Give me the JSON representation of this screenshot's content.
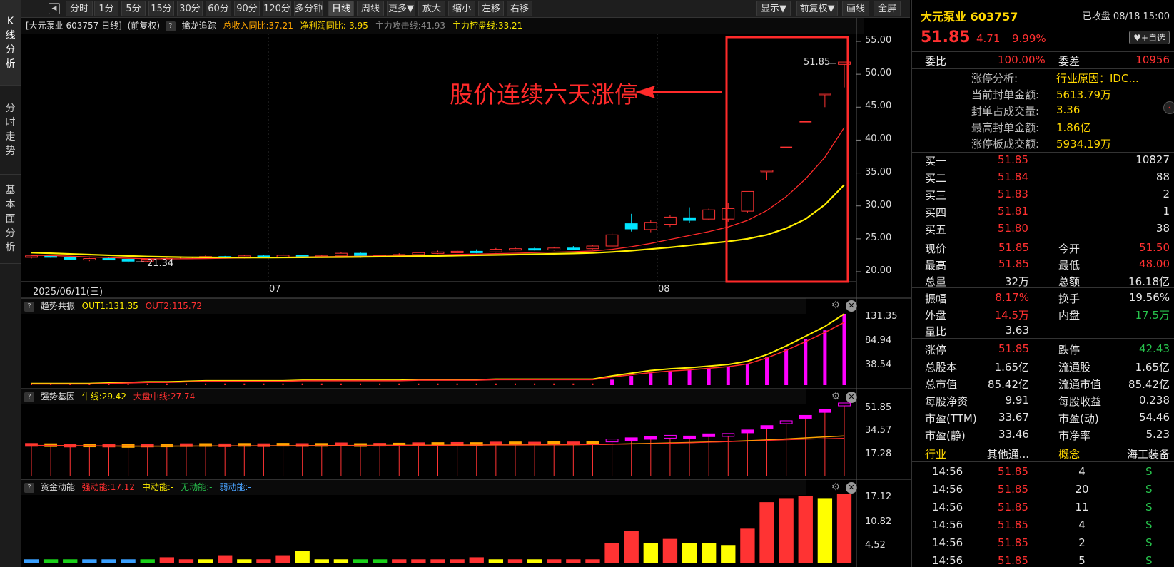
{
  "sidebar": {
    "tabs": [
      "K线分析",
      "分时走势",
      "基本面分析"
    ]
  },
  "toolbar": {
    "periods": [
      "分时",
      "1分",
      "5分",
      "15分",
      "30分",
      "60分",
      "90分",
      "120分",
      "多分钟",
      "日线",
      "周线",
      "更多▼",
      "放大",
      "缩小",
      "左移",
      "右移"
    ],
    "active": "日线",
    "right_buttons": [
      "显示▼",
      "前复权▼",
      "画线",
      "全屏"
    ]
  },
  "main_chart": {
    "header": {
      "stock": "[大元泵业 603757 日线]",
      "adjust": "(前复权)",
      "q": "?",
      "indicator": "擒龙追踪",
      "income": "总收入同比:37.21",
      "profit": "净利润同比:-3.95",
      "attack": "主力攻击线:41.93",
      "control": "主力控盘线:33.21"
    },
    "y_ticks": [
      "55.00",
      "50.00",
      "45.00",
      "40.00",
      "35.00",
      "30.00",
      "25.00",
      "20.00"
    ],
    "dates": [
      "2025/06/11(三)",
      "07",
      "08"
    ],
    "annotation": "股价连续六天涨停",
    "last_price_label": "51.85",
    "low_label": "21.34"
  },
  "sub1": {
    "q": "?",
    "name": "趋势共振",
    "out1": "OUT1:131.35",
    "out2": "OUT2:115.72",
    "y_ticks": [
      "131.35",
      "84.94",
      "38.54"
    ]
  },
  "sub2": {
    "q": "?",
    "name": "强势基因",
    "bull": "牛线:29.42",
    "market": "大盘中线:27.74",
    "y_ticks": [
      "51.85",
      "34.57",
      "17.28"
    ]
  },
  "sub3": {
    "q": "?",
    "name": "资金动能",
    "strong": "强动能:17.12",
    "mid": "中动能:-",
    "none": "无动能:-",
    "weak": "弱动能:-",
    "y_ticks": [
      "17.12",
      "10.82",
      "4.52"
    ]
  },
  "colors": {
    "up": "#ff3333",
    "down": "#00e5ff",
    "ma_red": "#ff2a2a",
    "ma_yellow": "#ffee00",
    "magenta": "#ff00ff",
    "grid": "#3a3a3a",
    "yellow_bar": "#ffff00"
  },
  "chart_data": [
    {
      "type": "candlestick",
      "title": "大元泵业 603757 日线",
      "x_start": "2025/06/11",
      "y_range": [
        20,
        55
      ],
      "ohlc": [
        [
          22.3,
          22.6,
          22.0,
          22.4
        ],
        [
          22.4,
          22.5,
          22.1,
          22.2
        ],
        [
          22.2,
          22.3,
          21.8,
          21.9
        ],
        [
          21.9,
          22.1,
          21.6,
          22.0
        ],
        [
          22.0,
          22.2,
          21.8,
          21.9
        ],
        [
          21.9,
          22.0,
          21.34,
          21.6
        ],
        [
          21.6,
          22.0,
          21.5,
          21.9
        ],
        [
          21.9,
          22.1,
          21.8,
          22.0
        ],
        [
          22.0,
          22.3,
          21.9,
          22.2
        ],
        [
          22.2,
          22.5,
          22.0,
          22.3
        ],
        [
          22.3,
          22.4,
          22.0,
          22.1
        ],
        [
          22.1,
          22.6,
          22.0,
          22.4
        ],
        [
          22.4,
          22.6,
          22.1,
          22.2
        ],
        [
          22.2,
          22.9,
          22.1,
          22.5
        ],
        [
          22.5,
          22.6,
          22.2,
          22.3
        ],
        [
          22.3,
          22.5,
          22.1,
          22.4
        ],
        [
          22.4,
          23.0,
          22.3,
          22.8
        ],
        [
          22.8,
          23.0,
          22.1,
          22.3
        ],
        [
          22.3,
          22.6,
          22.2,
          22.5
        ],
        [
          22.5,
          22.8,
          22.3,
          22.6
        ],
        [
          22.6,
          23.0,
          22.5,
          22.9
        ],
        [
          22.9,
          23.2,
          22.7,
          23.0
        ],
        [
          23.0,
          23.3,
          22.8,
          23.1
        ],
        [
          23.1,
          23.4,
          22.8,
          23.0
        ],
        [
          23.0,
          23.6,
          22.9,
          23.4
        ],
        [
          23.4,
          23.7,
          23.2,
          23.5
        ],
        [
          23.5,
          23.7,
          23.2,
          23.3
        ],
        [
          23.3,
          23.8,
          23.2,
          23.6
        ],
        [
          23.6,
          23.9,
          23.3,
          23.5
        ],
        [
          23.5,
          24.0,
          23.4,
          23.9
        ],
        [
          23.9,
          26.0,
          23.8,
          25.6
        ],
        [
          27.3,
          28.8,
          26.1,
          26.5
        ],
        [
          26.4,
          27.8,
          26.0,
          27.5
        ],
        [
          27.2,
          28.6,
          26.8,
          28.3
        ],
        [
          28.2,
          29.8,
          27.4,
          27.8
        ],
        [
          28.0,
          29.6,
          27.8,
          29.4
        ],
        [
          28.0,
          30.5,
          27.6,
          29.6
        ],
        [
          29.2,
          32.2,
          29.0,
          32.2
        ],
        [
          35.4,
          35.4,
          33.9,
          35.4
        ],
        [
          38.9,
          38.9,
          38.9,
          38.9
        ],
        [
          42.8,
          42.8,
          42.8,
          42.8
        ],
        [
          47.1,
          47.1,
          45.0,
          47.1
        ],
        [
          51.5,
          51.85,
          48.0,
          51.85
        ]
      ],
      "ma_red": [
        22.5,
        22.45,
        22.35,
        22.25,
        22.15,
        22.05,
        21.98,
        21.95,
        21.97,
        22.0,
        22.05,
        22.1,
        22.15,
        22.2,
        22.25,
        22.28,
        22.32,
        22.35,
        22.38,
        22.42,
        22.48,
        22.55,
        22.62,
        22.68,
        22.75,
        22.82,
        22.9,
        22.98,
        23.05,
        23.15,
        23.4,
        23.8,
        24.3,
        24.9,
        25.5,
        26.1,
        26.8,
        27.8,
        29.3,
        31.4,
        34.1,
        37.4,
        41.93
      ],
      "ma_yellow": [
        22.9,
        22.8,
        22.7,
        22.6,
        22.5,
        22.4,
        22.3,
        22.25,
        22.2,
        22.18,
        22.16,
        22.15,
        22.15,
        22.16,
        22.18,
        22.2,
        22.22,
        22.25,
        22.28,
        22.32,
        22.36,
        22.4,
        22.45,
        22.5,
        22.55,
        22.6,
        22.66,
        22.72,
        22.78,
        22.85,
        23.0,
        23.2,
        23.45,
        23.7,
        24.0,
        24.3,
        24.6,
        25.0,
        25.6,
        26.6,
        28.0,
        30.2,
        33.21
      ]
    },
    {
      "type": "bar+line",
      "title": "趋势共振",
      "y_range": [
        0,
        131.35
      ],
      "bars": [
        3,
        3,
        3,
        3,
        3,
        3,
        3,
        3,
        3,
        3,
        3,
        3,
        3,
        3,
        3,
        3,
        3,
        3,
        3,
        3,
        3,
        3,
        3,
        3,
        3,
        3,
        3,
        3,
        3,
        3,
        10,
        17,
        22,
        26,
        28,
        30,
        33,
        38,
        51,
        67,
        84,
        101,
        131.35
      ],
      "out1": [
        3,
        3,
        3,
        3,
        4,
        5,
        6,
        6,
        7,
        8,
        8,
        8,
        8,
        8,
        9,
        9,
        9,
        9,
        9,
        9,
        10,
        10,
        10,
        10,
        11,
        11,
        11,
        11,
        11,
        11,
        17,
        22,
        27,
        30,
        32,
        35,
        38,
        44,
        56,
        72,
        90,
        108,
        131.35
      ],
      "out2": [
        2,
        2,
        2,
        2,
        3,
        4,
        5,
        5,
        6,
        7,
        7,
        7,
        7,
        7,
        8,
        8,
        8,
        8,
        8,
        8,
        9,
        9,
        9,
        9,
        10,
        10,
        10,
        10,
        10,
        10,
        15,
        19,
        23,
        26,
        28,
        31,
        34,
        39,
        50,
        64,
        80,
        97,
        115.72
      ]
    },
    {
      "type": "bar+line",
      "title": "强势基因",
      "y_range": [
        0,
        51.85
      ],
      "bars": [
        22.4,
        22.2,
        21.9,
        22.0,
        21.9,
        21.6,
        21.9,
        22.0,
        22.2,
        22.3,
        22.1,
        22.4,
        22.2,
        22.5,
        22.3,
        22.4,
        22.8,
        22.3,
        22.5,
        22.6,
        22.9,
        23.0,
        23.1,
        23.0,
        23.4,
        23.5,
        23.3,
        23.6,
        23.5,
        23.9,
        25.6,
        26.5,
        27.5,
        28.3,
        27.8,
        29.4,
        29.6,
        32.2,
        35.4,
        38.9,
        42.8,
        47.1,
        51.85
      ],
      "bull": [
        22.5,
        22.4,
        22.3,
        22.2,
        22.1,
        22.0,
        22.0,
        22.0,
        22.05,
        22.1,
        22.15,
        22.2,
        22.25,
        22.3,
        22.35,
        22.4,
        22.45,
        22.5,
        22.55,
        22.6,
        22.65,
        22.7,
        22.75,
        22.8,
        22.85,
        22.9,
        22.95,
        23.0,
        23.1,
        23.2,
        23.4,
        23.7,
        24.0,
        24.3,
        24.6,
        25.0,
        25.4,
        25.9,
        26.5,
        27.2,
        28.0,
        28.7,
        29.42
      ],
      "market": [
        22.6,
        22.5,
        22.4,
        22.3,
        22.2,
        22.15,
        22.1,
        22.1,
        22.1,
        22.1,
        22.15,
        22.2,
        22.2,
        22.25,
        22.3,
        22.35,
        22.4,
        22.45,
        22.5,
        22.55,
        22.6,
        22.65,
        22.7,
        22.75,
        22.8,
        22.85,
        22.9,
        22.95,
        23.0,
        23.1,
        23.3,
        23.5,
        23.8,
        24.1,
        24.4,
        24.8,
        25.2,
        25.6,
        26.1,
        26.6,
        27.0,
        27.4,
        27.74
      ]
    },
    {
      "type": "bar",
      "title": "资金动能",
      "y_range": [
        0,
        17.12
      ],
      "values": [
        1.0,
        1.0,
        1.0,
        1.0,
        1.0,
        1.0,
        1.0,
        1.5,
        1.0,
        1.0,
        2.0,
        1.0,
        1.0,
        2.0,
        3.0,
        1.0,
        1.0,
        1.0,
        1.0,
        1.0,
        1.0,
        1.0,
        1.0,
        1.5,
        1.0,
        1.0,
        1.0,
        1.0,
        1.0,
        1.0,
        5.0,
        8.0,
        5.0,
        6.0,
        5.0,
        5.0,
        4.5,
        8.5,
        15.0,
        16.0,
        16.5,
        16.0,
        17.12
      ],
      "colors": [
        "cyan",
        "green",
        "green",
        "cyan",
        "cyan",
        "cyan",
        "green",
        "red",
        "red",
        "yellow",
        "red",
        "yellow",
        "red",
        "red",
        "yellow",
        "yellow",
        "yellow",
        "green",
        "green",
        "red",
        "red",
        "red",
        "red",
        "red",
        "yellow",
        "red",
        "yellow",
        "red",
        "red",
        "red",
        "red",
        "red",
        "yellow",
        "red",
        "yellow",
        "yellow",
        "yellow",
        "red",
        "red",
        "red",
        "red",
        "yellow",
        "red"
      ]
    }
  ],
  "quote": {
    "name": "大元泵业 603757",
    "status": "已收盘 08/18 15:00",
    "price": "51.85",
    "change": "4.71",
    "pct": "9.99%",
    "fav": "+自选",
    "weibi_label": "委比",
    "weibi": "100.00%",
    "weicha_label": "委差",
    "weicha": "10956",
    "limit_info": [
      {
        "k": "涨停分析:",
        "v": "行业原因：IDC..."
      },
      {
        "k": "当前封单金额:",
        "v": "5613.79万"
      },
      {
        "k": "封单占成交量:",
        "v": "3.36"
      },
      {
        "k": "最高封单金额:",
        "v": "1.86亿"
      },
      {
        "k": "涨停板成交额:",
        "v": "5934.19万"
      }
    ],
    "bids": [
      {
        "l": "买一",
        "p": "51.85",
        "v": "10827"
      },
      {
        "l": "买二",
        "p": "51.84",
        "v": "88"
      },
      {
        "l": "买三",
        "p": "51.83",
        "v": "2"
      },
      {
        "l": "买四",
        "p": "51.81",
        "v": "1"
      },
      {
        "l": "买五",
        "p": "51.80",
        "v": "38"
      }
    ],
    "stats1": [
      {
        "l1": "现价",
        "v1": "51.85",
        "l2": "今开",
        "v2": "51.50"
      },
      {
        "l1": "最高",
        "v1": "51.85",
        "l2": "最低",
        "v2": "48.00"
      },
      {
        "l1": "总量",
        "v1": "32万",
        "l2": "总额",
        "v2": "16.18亿"
      }
    ],
    "stats2": [
      {
        "l1": "振幅",
        "v1": "8.17%",
        "l2": "换手",
        "v2": "19.56%"
      },
      {
        "l1": "外盘",
        "v1": "14.5万",
        "l2": "内盘",
        "v2": "17.5万"
      },
      {
        "l1": "量比",
        "v1": "3.63"
      }
    ],
    "limits": {
      "l1": "涨停",
      "v1": "51.85",
      "l2": "跌停",
      "v2": "42.43"
    },
    "stats3": [
      {
        "l1": "总股本",
        "v1": "1.65亿",
        "l2": "流通股",
        "v2": "1.65亿"
      },
      {
        "l1": "总市值",
        "v1": "85.42亿",
        "l2": "流通市值",
        "v2": "85.42亿"
      },
      {
        "l1": "每股净资",
        "v1": "9.91",
        "l2": "每股收益",
        "v2": "0.238"
      },
      {
        "l1": "市盈(TTM)",
        "v1": "33.67",
        "l2": "市盈(动)",
        "v2": "54.46"
      },
      {
        "l1": "市盈(静)",
        "v1": "33.46",
        "l2": "市净率",
        "v2": "5.23"
      }
    ],
    "industry": {
      "l1": "行业",
      "v1": "其他通...",
      "l2": "概念",
      "v2": "海工装备"
    },
    "ticks": [
      {
        "t": "14:56",
        "p": "51.85",
        "v": "4",
        "s": "S"
      },
      {
        "t": "14:56",
        "p": "51.85",
        "v": "20",
        "s": "S"
      },
      {
        "t": "14:56",
        "p": "51.85",
        "v": "11",
        "s": "S"
      },
      {
        "t": "14:56",
        "p": "51.85",
        "v": "4",
        "s": "S"
      },
      {
        "t": "14:56",
        "p": "51.85",
        "v": "2",
        "s": "S"
      },
      {
        "t": "14:56",
        "p": "51.85",
        "v": "5",
        "s": "S"
      }
    ]
  }
}
